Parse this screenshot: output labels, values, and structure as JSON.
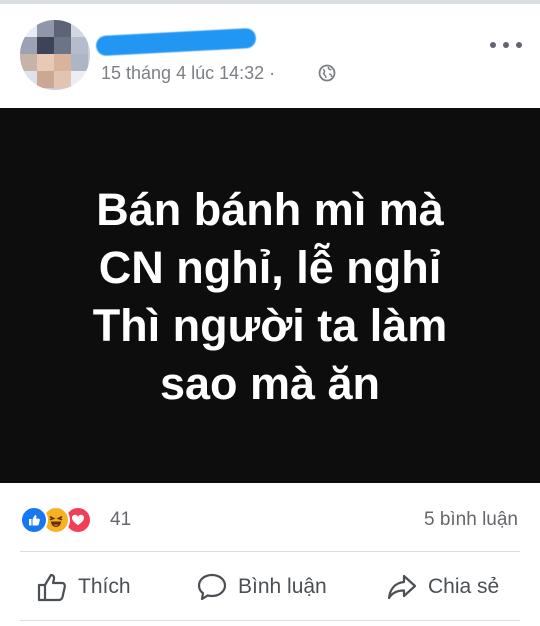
{
  "post": {
    "timestamp": "15 tháng 4 lúc 14:32 ·",
    "privacy_icon": "globe-icon",
    "more_icon": "more-horizontal-icon",
    "image_text_lines": [
      "Bán bánh mì mà",
      "CN nghỉ, lễ nghỉ",
      "Thì người ta làm",
      "sao mà ăn"
    ],
    "image_background": "#0d0d0d",
    "image_text_color": "#ffffff"
  },
  "reactions": {
    "icons": [
      "like-reaction-icon",
      "haha-reaction-icon",
      "love-reaction-icon"
    ],
    "count": "41",
    "comments": "5 bình luận"
  },
  "actions": {
    "like_label": "Thích",
    "comment_label": "Bình luận",
    "share_label": "Chia sẻ"
  },
  "colors": {
    "like": "#1877f2",
    "haha": "#f7b125",
    "love": "#f33e58",
    "secondary_text": "#65676b"
  }
}
